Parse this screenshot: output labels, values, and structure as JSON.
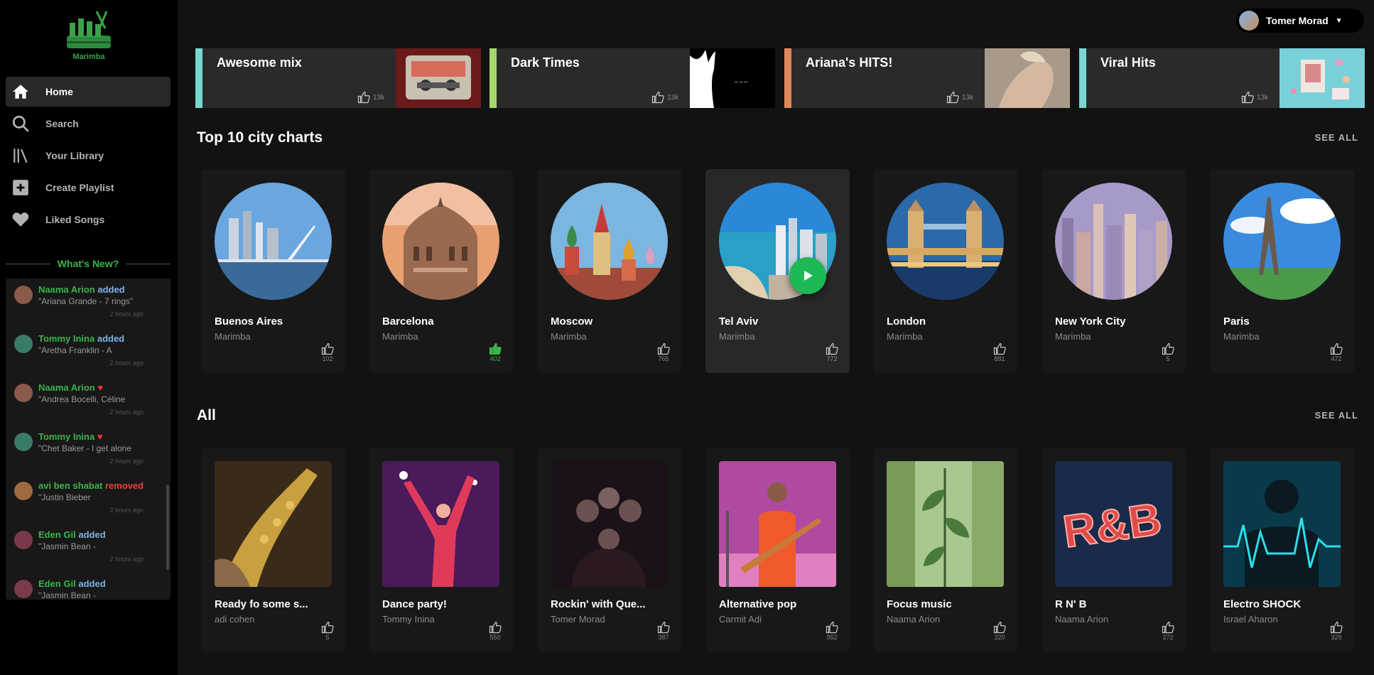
{
  "app": {
    "logo_text": "Marimba"
  },
  "sidebar": {
    "items": [
      {
        "label": "Home",
        "icon": "home-icon",
        "active": true
      },
      {
        "label": "Search",
        "icon": "search-icon",
        "active": false
      },
      {
        "label": "Your Library",
        "icon": "library-icon",
        "active": false
      },
      {
        "label": "Create Playlist",
        "icon": "plus-square-icon",
        "active": false
      },
      {
        "label": "Liked Songs",
        "icon": "heart-icon",
        "active": false
      }
    ],
    "whats_new_label": "What's New?"
  },
  "feed": [
    {
      "user": "Naama Arion",
      "action": "added",
      "detail": "\"Ariana Grande - 7 rings\"",
      "time": "2 hours ago",
      "avatar_color": "#8a5a4a"
    },
    {
      "user": "Tommy Inina",
      "action": "added",
      "detail": "\"Aretha Franklin - A",
      "time": "2 hours ago",
      "avatar_color": "#3a7a6a"
    },
    {
      "user": "Naama Arion",
      "action": "♥",
      "detail": "\"Andrea Bocelli, Céline",
      "time": "2 hours ago",
      "avatar_color": "#8a5a4a"
    },
    {
      "user": "Tommy Inina",
      "action": "♥",
      "detail": "\"Chet Baker - I get alone",
      "time": "2 hours ago",
      "avatar_color": "#3a7a6a"
    },
    {
      "user": "avi ben shabat",
      "action": "removed",
      "detail": "\"Justin Bieber",
      "time": "2 hours ago",
      "avatar_color": "#a06a40"
    },
    {
      "user": "Eden Gil",
      "action": "added",
      "detail": "\"Jasmin Bean -",
      "time": "2 hours ago",
      "avatar_color": "#7a3a4a"
    },
    {
      "user": "Eden Gil",
      "action": "added",
      "detail": "\"Jasmin Bean -",
      "time": "",
      "avatar_color": "#7a3a4a"
    }
  ],
  "header": {
    "user_name": "Tomer Morad"
  },
  "featured": [
    {
      "title": "Awesome mix",
      "likes": "13k",
      "accent": "#7ad6d0"
    },
    {
      "title": "Dark Times",
      "likes": "13k",
      "accent": "#a6d86a"
    },
    {
      "title": "Ariana's HITS!",
      "likes": "13k",
      "accent": "#e0875a"
    },
    {
      "title": "Viral Hits",
      "likes": "13k",
      "accent": "#7ad6d0"
    }
  ],
  "sections": {
    "city": {
      "title": "Top 10 city charts",
      "see_all": "SEE ALL"
    },
    "all": {
      "title": "All",
      "see_all": "SEE ALL"
    }
  },
  "city_cards": [
    {
      "title": "Buenos Aires",
      "sub": "Marimba",
      "likes": "102",
      "liked": false
    },
    {
      "title": "Barcelona",
      "sub": "Marimba",
      "likes": "402",
      "liked": true
    },
    {
      "title": "Moscow",
      "sub": "Marimba",
      "likes": "765",
      "liked": false
    },
    {
      "title": "Tel Aviv",
      "sub": "Marimba",
      "likes": "772",
      "liked": false,
      "hover": true
    },
    {
      "title": "London",
      "sub": "Marimba",
      "likes": "881",
      "liked": false
    },
    {
      "title": "New York City",
      "sub": "Marimba",
      "likes": "5",
      "liked": false
    },
    {
      "title": "Paris",
      "sub": "Marimba",
      "likes": "472",
      "liked": false
    }
  ],
  "all_cards": [
    {
      "title": "Ready fo some s...",
      "sub": "adi cohen",
      "likes": "5"
    },
    {
      "title": "Dance party!",
      "sub": "Tommy Inina",
      "likes": "550"
    },
    {
      "title": "Rockin' with Que...",
      "sub": "Tomer Morad",
      "likes": "387"
    },
    {
      "title": "Alternative pop",
      "sub": "Carmit Adi",
      "likes": "952"
    },
    {
      "title": "Focus music",
      "sub": "Naama Arion",
      "likes": "220"
    },
    {
      "title": "R N' B",
      "sub": "Naama Arion",
      "likes": "272"
    },
    {
      "title": "Electro SHOCK",
      "sub": "Israel Aharon",
      "likes": "329"
    }
  ]
}
